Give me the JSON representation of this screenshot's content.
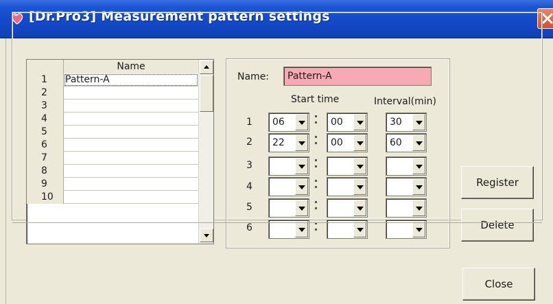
{
  "window": {
    "title": "[Dr.Pro3] Measurement pattern settings",
    "icon": "heart-app-icon",
    "close_icon": "close-icon"
  },
  "list": {
    "header": "Name",
    "rows": [
      {
        "num": "1",
        "name": "Pattern-A"
      },
      {
        "num": "2",
        "name": ""
      },
      {
        "num": "3",
        "name": ""
      },
      {
        "num": "4",
        "name": ""
      },
      {
        "num": "5",
        "name": ""
      },
      {
        "num": "6",
        "name": ""
      },
      {
        "num": "7",
        "name": ""
      },
      {
        "num": "8",
        "name": ""
      },
      {
        "num": "9",
        "name": ""
      },
      {
        "num": "10",
        "name": ""
      }
    ]
  },
  "settings": {
    "name_label": "Name:",
    "name_value": "Pattern-A",
    "start_time_label": "Start time",
    "interval_label": "Interval(min)",
    "rows": [
      {
        "num": "1",
        "hour": "06",
        "minute": "00",
        "interval": "30"
      },
      {
        "num": "2",
        "hour": "22",
        "minute": "00",
        "interval": "60"
      },
      {
        "num": "3",
        "hour": "",
        "minute": "",
        "interval": ""
      },
      {
        "num": "4",
        "hour": "",
        "minute": "",
        "interval": ""
      },
      {
        "num": "5",
        "hour": "",
        "minute": "",
        "interval": ""
      },
      {
        "num": "6",
        "hour": "",
        "minute": "",
        "interval": ""
      }
    ]
  },
  "buttons": {
    "register": "Register",
    "delete": "Delete",
    "close": "Close"
  },
  "colors": {
    "titlebar": "#1449c9",
    "name_field": "#f7a9b4",
    "face": "#ece9d8"
  }
}
